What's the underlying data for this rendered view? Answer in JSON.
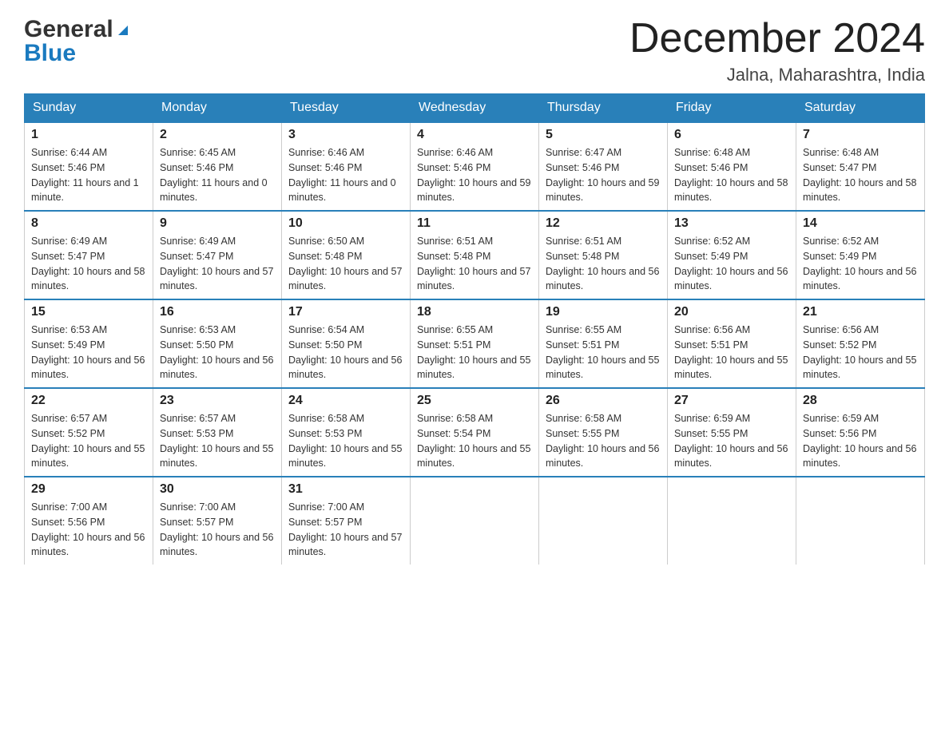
{
  "header": {
    "logo_general": "General",
    "logo_blue": "Blue",
    "month_title": "December 2024",
    "location": "Jalna, Maharashtra, India"
  },
  "days_of_week": [
    "Sunday",
    "Monday",
    "Tuesday",
    "Wednesday",
    "Thursday",
    "Friday",
    "Saturday"
  ],
  "weeks": [
    [
      {
        "day": "1",
        "sunrise": "6:44 AM",
        "sunset": "5:46 PM",
        "daylight": "11 hours and 1 minute."
      },
      {
        "day": "2",
        "sunrise": "6:45 AM",
        "sunset": "5:46 PM",
        "daylight": "11 hours and 0 minutes."
      },
      {
        "day": "3",
        "sunrise": "6:46 AM",
        "sunset": "5:46 PM",
        "daylight": "11 hours and 0 minutes."
      },
      {
        "day": "4",
        "sunrise": "6:46 AM",
        "sunset": "5:46 PM",
        "daylight": "10 hours and 59 minutes."
      },
      {
        "day": "5",
        "sunrise": "6:47 AM",
        "sunset": "5:46 PM",
        "daylight": "10 hours and 59 minutes."
      },
      {
        "day": "6",
        "sunrise": "6:48 AM",
        "sunset": "5:46 PM",
        "daylight": "10 hours and 58 minutes."
      },
      {
        "day": "7",
        "sunrise": "6:48 AM",
        "sunset": "5:47 PM",
        "daylight": "10 hours and 58 minutes."
      }
    ],
    [
      {
        "day": "8",
        "sunrise": "6:49 AM",
        "sunset": "5:47 PM",
        "daylight": "10 hours and 58 minutes."
      },
      {
        "day": "9",
        "sunrise": "6:49 AM",
        "sunset": "5:47 PM",
        "daylight": "10 hours and 57 minutes."
      },
      {
        "day": "10",
        "sunrise": "6:50 AM",
        "sunset": "5:48 PM",
        "daylight": "10 hours and 57 minutes."
      },
      {
        "day": "11",
        "sunrise": "6:51 AM",
        "sunset": "5:48 PM",
        "daylight": "10 hours and 57 minutes."
      },
      {
        "day": "12",
        "sunrise": "6:51 AM",
        "sunset": "5:48 PM",
        "daylight": "10 hours and 56 minutes."
      },
      {
        "day": "13",
        "sunrise": "6:52 AM",
        "sunset": "5:49 PM",
        "daylight": "10 hours and 56 minutes."
      },
      {
        "day": "14",
        "sunrise": "6:52 AM",
        "sunset": "5:49 PM",
        "daylight": "10 hours and 56 minutes."
      }
    ],
    [
      {
        "day": "15",
        "sunrise": "6:53 AM",
        "sunset": "5:49 PM",
        "daylight": "10 hours and 56 minutes."
      },
      {
        "day": "16",
        "sunrise": "6:53 AM",
        "sunset": "5:50 PM",
        "daylight": "10 hours and 56 minutes."
      },
      {
        "day": "17",
        "sunrise": "6:54 AM",
        "sunset": "5:50 PM",
        "daylight": "10 hours and 56 minutes."
      },
      {
        "day": "18",
        "sunrise": "6:55 AM",
        "sunset": "5:51 PM",
        "daylight": "10 hours and 55 minutes."
      },
      {
        "day": "19",
        "sunrise": "6:55 AM",
        "sunset": "5:51 PM",
        "daylight": "10 hours and 55 minutes."
      },
      {
        "day": "20",
        "sunrise": "6:56 AM",
        "sunset": "5:51 PM",
        "daylight": "10 hours and 55 minutes."
      },
      {
        "day": "21",
        "sunrise": "6:56 AM",
        "sunset": "5:52 PM",
        "daylight": "10 hours and 55 minutes."
      }
    ],
    [
      {
        "day": "22",
        "sunrise": "6:57 AM",
        "sunset": "5:52 PM",
        "daylight": "10 hours and 55 minutes."
      },
      {
        "day": "23",
        "sunrise": "6:57 AM",
        "sunset": "5:53 PM",
        "daylight": "10 hours and 55 minutes."
      },
      {
        "day": "24",
        "sunrise": "6:58 AM",
        "sunset": "5:53 PM",
        "daylight": "10 hours and 55 minutes."
      },
      {
        "day": "25",
        "sunrise": "6:58 AM",
        "sunset": "5:54 PM",
        "daylight": "10 hours and 55 minutes."
      },
      {
        "day": "26",
        "sunrise": "6:58 AM",
        "sunset": "5:55 PM",
        "daylight": "10 hours and 56 minutes."
      },
      {
        "day": "27",
        "sunrise": "6:59 AM",
        "sunset": "5:55 PM",
        "daylight": "10 hours and 56 minutes."
      },
      {
        "day": "28",
        "sunrise": "6:59 AM",
        "sunset": "5:56 PM",
        "daylight": "10 hours and 56 minutes."
      }
    ],
    [
      {
        "day": "29",
        "sunrise": "7:00 AM",
        "sunset": "5:56 PM",
        "daylight": "10 hours and 56 minutes."
      },
      {
        "day": "30",
        "sunrise": "7:00 AM",
        "sunset": "5:57 PM",
        "daylight": "10 hours and 56 minutes."
      },
      {
        "day": "31",
        "sunrise": "7:00 AM",
        "sunset": "5:57 PM",
        "daylight": "10 hours and 57 minutes."
      },
      null,
      null,
      null,
      null
    ]
  ]
}
